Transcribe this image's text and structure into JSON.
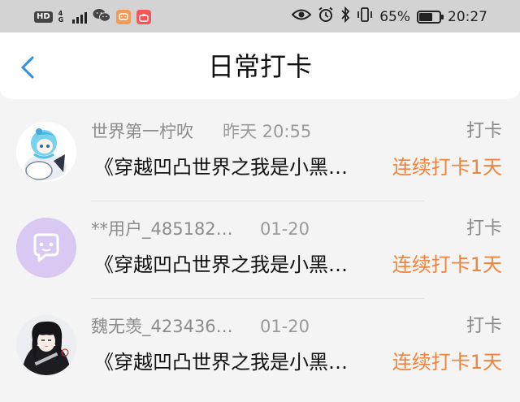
{
  "status_bar": {
    "hd": "HD",
    "network": "4G",
    "battery_percent": "65%",
    "battery_level": 0.65,
    "time": "20:27",
    "icons": [
      "signal-icon",
      "wechat-icon",
      "chat-app-icon",
      "shopping-app-icon",
      "eye-icon",
      "alarm-icon",
      "bluetooth-icon",
      "vibrate-icon",
      "battery-icon"
    ]
  },
  "header": {
    "title": "日常打卡",
    "back_icon": "chevron-left-icon"
  },
  "colors": {
    "accent_orange": "#f0843c",
    "back_blue": "#2f8ee6",
    "avatar_purple": "#d9c8f2"
  },
  "records": [
    {
      "name": "世界第一柠吹",
      "date": "昨天 20:55",
      "action": "打卡",
      "book": "《穿越凹凸世界之我是小黑…",
      "streak": "连续打卡1天"
    },
    {
      "name": "**用户_485182…",
      "date": "01-20",
      "action": "打卡",
      "book": "《穿越凹凸世界之我是小黑…",
      "streak": "连续打卡1天"
    },
    {
      "name": "魏无羡_423436…",
      "date": "01-20",
      "action": "打卡",
      "book": "《穿越凹凸世界之我是小黑…",
      "streak": "连续打卡1天"
    }
  ]
}
